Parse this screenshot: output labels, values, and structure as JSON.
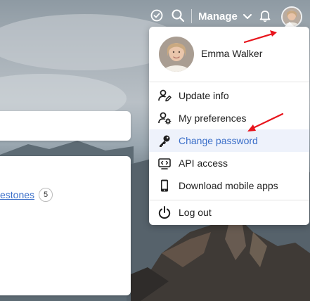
{
  "topbar": {
    "manage_label": "Manage",
    "icons": [
      "clock-check-icon",
      "search-icon",
      "chevron-down-icon",
      "bell-icon"
    ]
  },
  "background": {
    "milestones_link": "estones",
    "milestones_count": "5"
  },
  "profile_menu": {
    "user_name": "Emma Walker",
    "items": [
      {
        "label": "Update info",
        "icon": "user-edit-icon"
      },
      {
        "label": "My preferences",
        "icon": "user-settings-icon"
      },
      {
        "label": "Change password",
        "icon": "key-icon",
        "highlighted": true
      },
      {
        "label": "API access",
        "icon": "api-icon"
      },
      {
        "label": "Download mobile apps",
        "icon": "mobile-icon"
      },
      {
        "label": "Log out",
        "icon": "power-icon"
      }
    ]
  },
  "colors": {
    "accent": "#3b6fc9",
    "annotation_arrow": "#e8141c",
    "highlight_bg": "#eef2fb"
  }
}
